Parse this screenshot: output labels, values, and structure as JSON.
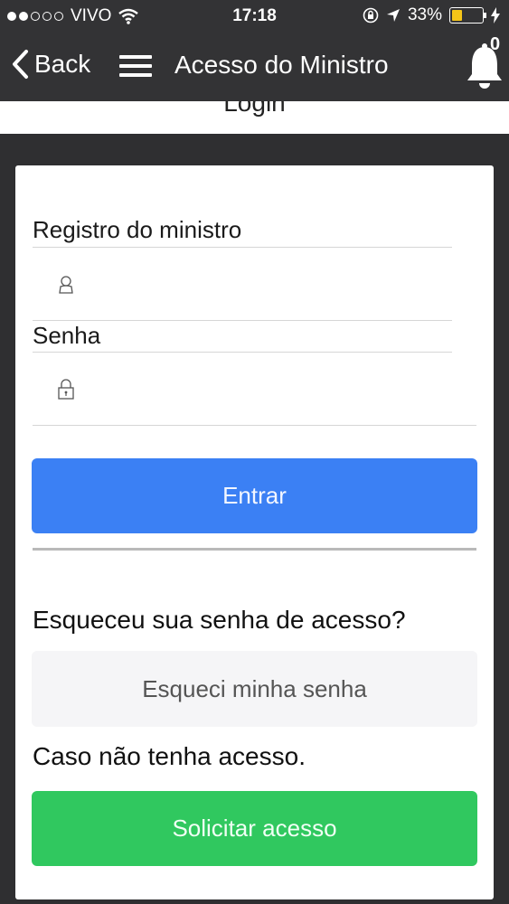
{
  "status_bar": {
    "carrier": "VIVO",
    "time": "17:18",
    "battery_percent": "33%",
    "battery_level": 0.33,
    "icons": [
      "signal-dots-icon",
      "wifi-icon",
      "rotation-lock-icon",
      "location-arrow-icon",
      "battery-icon",
      "charging-bolt-icon"
    ]
  },
  "navbar": {
    "back_label": "Back",
    "title": "Acesso do Ministro",
    "notification_count": "0"
  },
  "page": {
    "section_title": "Login"
  },
  "form": {
    "registro_label": "Registro do ministro",
    "registro_value": "",
    "senha_label": "Senha",
    "senha_value": "",
    "submit_label": "Entrar"
  },
  "forgot": {
    "heading": "Esqueceu sua senha de acesso?",
    "button_label": "Esqueci minha senha"
  },
  "request": {
    "heading": "Caso não tenha acesso.",
    "button_label": "Solicitar acesso"
  },
  "colors": {
    "header_bg": "#333335",
    "page_bg": "#2f2f31",
    "primary": "#3b80f4",
    "success": "#30c85f",
    "secondary_bg": "#f5f5f7",
    "battery": "#f5c518"
  }
}
